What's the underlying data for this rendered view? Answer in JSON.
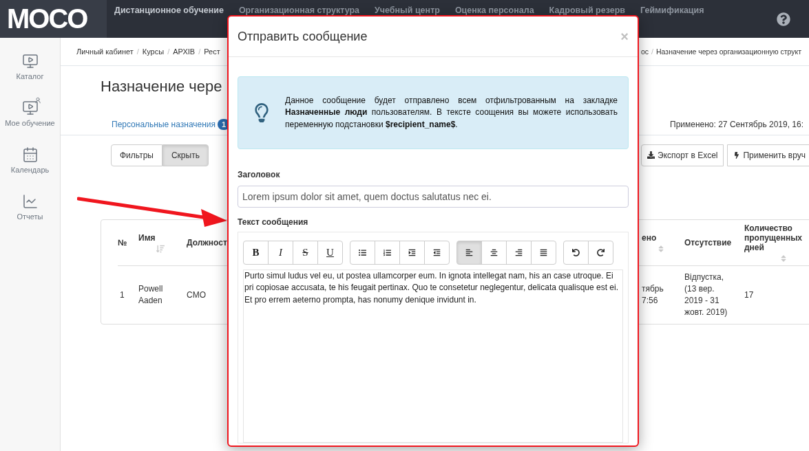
{
  "topbar": {
    "logo": "MOCO",
    "nav": [
      {
        "label": "Дистанционное обучение",
        "selected": true
      },
      {
        "label": "Организационная структура",
        "selected": false
      },
      {
        "label": "Учебный центр",
        "selected": false
      },
      {
        "label": "Оценка персонала",
        "selected": false
      },
      {
        "label": "Кадровый резерв",
        "selected": false
      },
      {
        "label": "Геймификация",
        "selected": false
      }
    ]
  },
  "sidebar": {
    "items": [
      {
        "kind": "catalog",
        "label": "Каталог"
      },
      {
        "kind": "learning",
        "label": "Мое обучение"
      },
      {
        "kind": "calendar",
        "label": "Календарь"
      },
      {
        "kind": "reports",
        "label": "Отчеты"
      }
    ]
  },
  "breadcrumbs": {
    "separator": "/",
    "left": [
      "Личный кабинет",
      "Курсы",
      "АРХІВ",
      "Рест"
    ],
    "right": [
      "ос",
      "Назначение через организационную структ"
    ]
  },
  "page_title": "Назначение чере",
  "tabs": [
    {
      "label": "Персональные назначения",
      "badge": "1"
    }
  ],
  "applied": "Применено: 27 Сентябрь 2019, 16:",
  "filter_buttons": [
    {
      "label": "Фильтры",
      "selected": false
    },
    {
      "label": "Скрыть",
      "selected": true
    }
  ],
  "action_buttons": [
    {
      "kind": "export",
      "label": "Экспорт в Excel"
    },
    {
      "kind": "apply",
      "label": "Применить вруч"
    }
  ],
  "table": {
    "columns": [
      {
        "label": "№",
        "sortable": false
      },
      {
        "label": "Имя",
        "sortable": true
      },
      {
        "label": "Должност",
        "sortable": false
      },
      {
        "label": "ено",
        "sortable": true
      },
      {
        "label": "Отсутствие",
        "sortable": false
      },
      {
        "label": "Количество пропущенных дней",
        "sortable": true
      }
    ],
    "rows": [
      [
        "1",
        "Powell Aaden",
        "CMO",
        "тябрь 7:56",
        "Відпустка, (13 вер. 2019 - 31 жовт. 2019)",
        "17"
      ]
    ]
  },
  "modal": {
    "title": "Отправить сообщение",
    "close": "×",
    "info": "Данное сообщение будет отправлено всем отфильтрованным на закладке **Назначенные люди** пользователям. В тексте соощения вы можете использовать переменную подстановки **$recipient_name$**.",
    "subject_label": "Заголовок",
    "subject_value": "Lorem ipsum dolor sit amet, quem doctus salutatus nec ei.",
    "body_label": "Текст сообщения",
    "toolbar": [
      [
        {
          "kind": "bold",
          "label": "B",
          "selected": false
        },
        {
          "kind": "italic",
          "label": "I",
          "selected": false
        },
        {
          "kind": "strike",
          "label": "S",
          "selected": false
        },
        {
          "kind": "underline",
          "label": "U",
          "selected": false
        }
      ],
      [
        {
          "kind": "bullets",
          "selected": false
        },
        {
          "kind": "numbers",
          "selected": false
        },
        {
          "kind": "indent",
          "selected": false
        },
        {
          "kind": "outdent",
          "selected": false
        }
      ],
      [
        {
          "kind": "align-left",
          "selected": true
        },
        {
          "kind": "align-center",
          "selected": false
        },
        {
          "kind": "align-right",
          "selected": false
        },
        {
          "kind": "justify",
          "selected": false
        }
      ],
      [
        {
          "kind": "undo",
          "selected": false
        },
        {
          "kind": "redo",
          "selected": false
        }
      ]
    ],
    "body_value": "Purto simul ludus vel eu, ut postea ullamcorper eum. In ignota intellegat nam, his an case utroque. Ei pri copiosae accusata, te his feugait pertinax. Quo te consetetur neglegentur, delicata qualisque est ei. Et pro errem aeterno prompta, has nonumy denique invidunt in."
  }
}
